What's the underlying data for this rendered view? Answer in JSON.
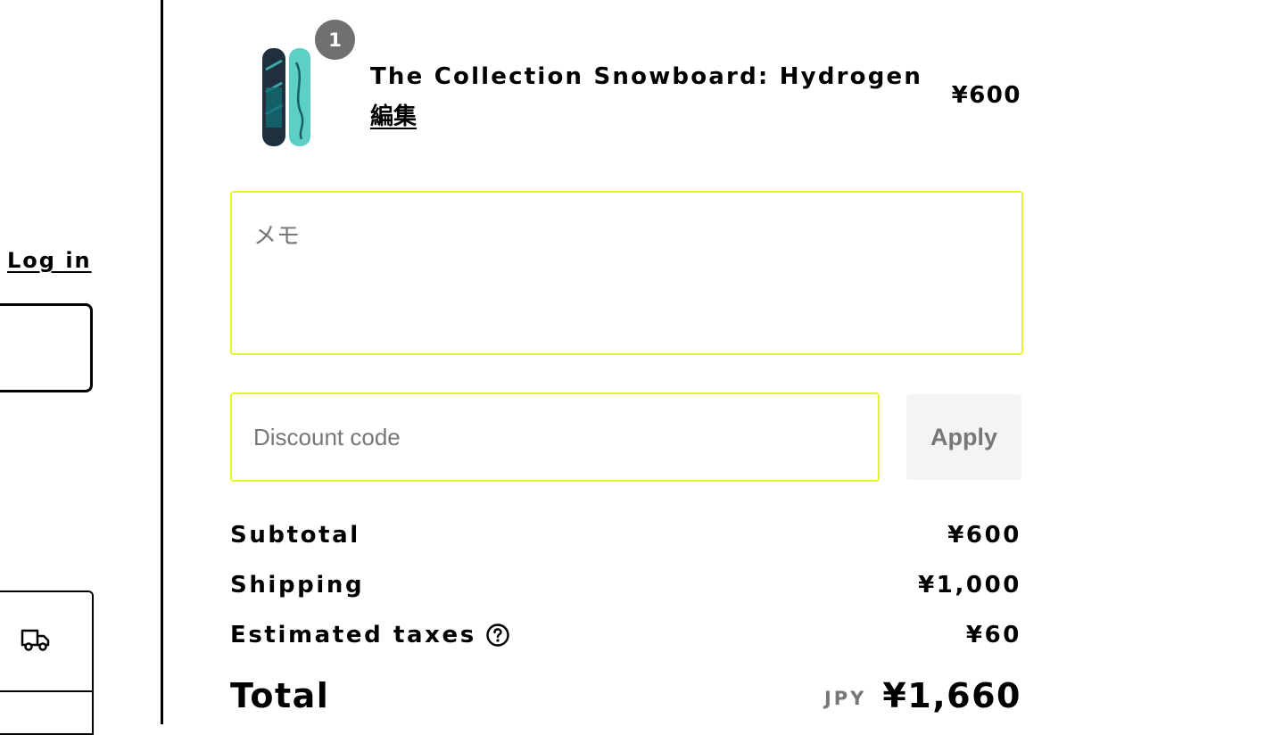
{
  "sidebar": {
    "login_label": "Log in"
  },
  "product": {
    "name": "The Collection Snowboard: Hydrogen",
    "quantity": "1",
    "edit_label": "編集",
    "price": "¥600",
    "icon": "snowboard-image"
  },
  "note": {
    "placeholder": "メモ",
    "value": ""
  },
  "discount": {
    "placeholder": "Discount code",
    "apply_label": "Apply"
  },
  "summary": {
    "subtotal_label": "Subtotal",
    "subtotal_value": "¥600",
    "shipping_label": "Shipping",
    "shipping_value": "¥1,000",
    "taxes_label": "Estimated taxes",
    "taxes_value": "¥60",
    "total_label": "Total",
    "currency": "JPY",
    "total_value": "¥1,660"
  },
  "colors": {
    "focus_border": "#e4f72b",
    "badge": "#707070",
    "button_bg": "#f4f4f4"
  }
}
